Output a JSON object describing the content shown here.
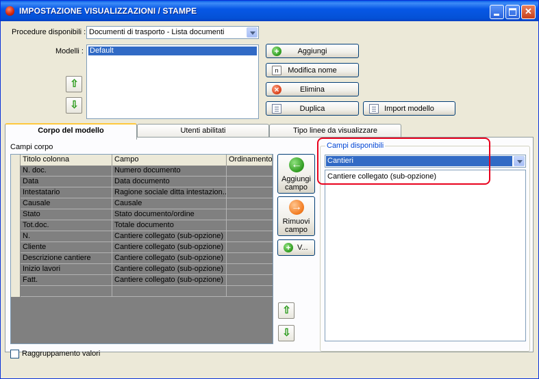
{
  "window": {
    "title": "IMPOSTAZIONE VISUALIZZAZIONI / STAMPE"
  },
  "procedure": {
    "label": "Procedure disponibili :",
    "selected": "Documenti di trasporto - Lista documenti"
  },
  "modelli": {
    "label": "Modelli :",
    "items": [
      "Default"
    ]
  },
  "buttons": {
    "aggiungi": "Aggiungi",
    "modifica_nome": "Modifica nome",
    "elimina": "Elimina",
    "duplica": "Duplica",
    "import_modello": "Import modello"
  },
  "tabs": [
    {
      "label": "Corpo del modello"
    },
    {
      "label": "Utenti abilitati"
    },
    {
      "label": "Tipo linee da visualizzare"
    }
  ],
  "campi_corpo": {
    "label": "Campi corpo",
    "columns": [
      "Titolo colonna",
      "Campo",
      "Ordinamento"
    ],
    "rows": [
      [
        "N. doc.",
        "Numero documento",
        ""
      ],
      [
        "Data",
        "Data documento",
        ""
      ],
      [
        "Intestatario",
        "Ragione sociale ditta intestazion...",
        ""
      ],
      [
        "Causale",
        "Causale",
        ""
      ],
      [
        "Stato",
        "Stato documento/ordine",
        ""
      ],
      [
        "Tot.doc.",
        "Totale documento",
        ""
      ],
      [
        "N.",
        "Cantiere collegato (sub-opzione)",
        ""
      ],
      [
        "Cliente",
        "Cantiere collegato (sub-opzione)",
        ""
      ],
      [
        "Descrizione cantiere",
        "Cantiere collegato (sub-opzione)",
        ""
      ],
      [
        "Inizio lavori",
        "Cantiere collegato (sub-opzione)",
        ""
      ],
      [
        "Fatt.",
        "Cantiere collegato (sub-opzione)",
        ""
      ],
      [
        "",
        "",
        ""
      ]
    ]
  },
  "side_buttons": {
    "aggiungi_campo": [
      "Aggiungi",
      "campo"
    ],
    "rimuovi_campo": [
      "Rimuovi",
      "campo"
    ],
    "v": "V..."
  },
  "campi_disponibili": {
    "label": "Campi disponibili",
    "selected": "Cantieri",
    "items": [
      "Cantiere collegato (sub-opzione)"
    ]
  },
  "raggruppamento": {
    "label": "Raggruppamento valori",
    "checked": false
  }
}
